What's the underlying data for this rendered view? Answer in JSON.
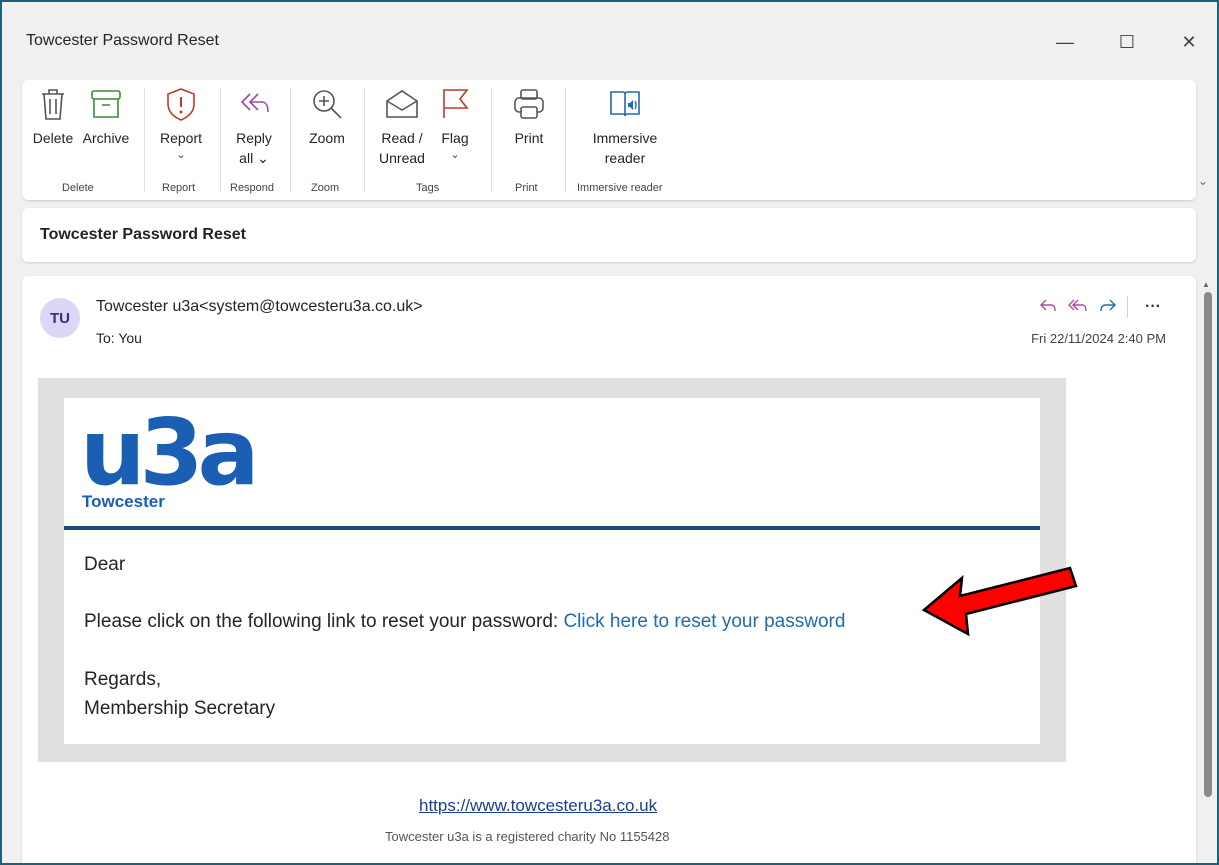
{
  "window": {
    "title": "Towcester Password Reset",
    "minimize": "—",
    "maximize": "☐",
    "close": "✕"
  },
  "ribbon": {
    "buttons": {
      "delete": "Delete",
      "archive": "Archive",
      "report": "Report",
      "reply_all_1": "Reply",
      "reply_all_2": "all ⌄",
      "zoom": "Zoom",
      "read_unread_1": "Read /",
      "read_unread_2": "Unread",
      "flag": "Flag",
      "print": "Print",
      "immersive_1": "Immersive",
      "immersive_2": "reader"
    },
    "groups": {
      "delete": "Delete",
      "report": "Report",
      "respond": "Respond",
      "zoom": "Zoom",
      "tags": "Tags",
      "print": "Print",
      "immersive": "Immersive reader"
    },
    "caret": "⌄",
    "expand": "⌄"
  },
  "subject": "Towcester Password Reset",
  "message": {
    "avatar_initials": "TU",
    "sender": "Towcester u3a<system@towcesteru3a.co.uk>",
    "to": "To:  You",
    "date": "Fri 22/11/2024 2:40 PM",
    "more": "···"
  },
  "email": {
    "logo_text": "u3a",
    "logo_sub": "Towcester",
    "greeting": "Dear",
    "instruction": "Please click on the following link to reset your password: ",
    "reset_link": "Click here to reset your password",
    "regards": "Regards,",
    "signature": "Membership Secretary",
    "footer_link": "https://www.towcesteru3a.co.uk",
    "footer_charity": "Towcester u3a is a registered charity No 1155428"
  },
  "colors": {
    "brand_blue": "#1a5fb4",
    "link_blue": "#1e6bb0",
    "arrow_red": "#ff0000",
    "reply_purple": "#b04a9c"
  }
}
